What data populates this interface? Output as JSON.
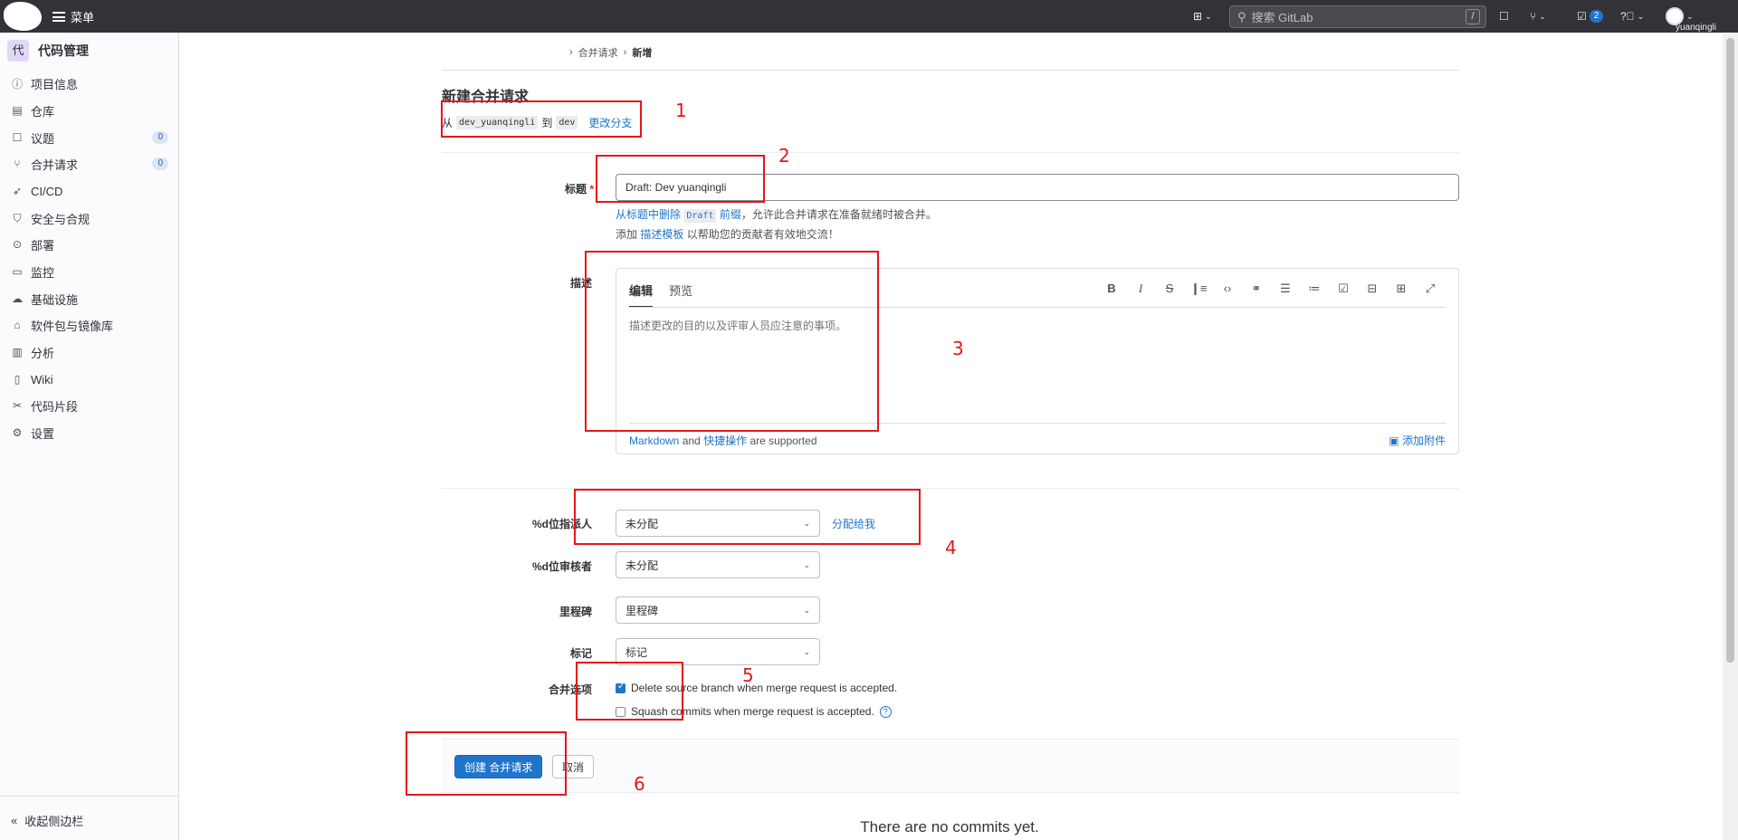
{
  "topbar": {
    "menu_label": "菜单",
    "search_placeholder": "搜索 GitLab",
    "search_shortcut": "/",
    "todo_count": "2",
    "username": "yuanqingli"
  },
  "sidebar": {
    "project_initial": "代",
    "project_name": "代码管理",
    "items": [
      {
        "label": "项目信息",
        "icon": "info-icon"
      },
      {
        "label": "仓库",
        "icon": "doc-icon"
      },
      {
        "label": "议题",
        "icon": "issues-icon",
        "badge": "0"
      },
      {
        "label": "合并请求",
        "icon": "merge-icon",
        "badge": "0"
      },
      {
        "label": "CI/CD",
        "icon": "rocket-icon"
      },
      {
        "label": "安全与合规",
        "icon": "shield-icon"
      },
      {
        "label": "部署",
        "icon": "deploy-icon"
      },
      {
        "label": "监控",
        "icon": "monitor-icon"
      },
      {
        "label": "基础设施",
        "icon": "cloud-icon"
      },
      {
        "label": "软件包与镜像库",
        "icon": "package-icon"
      },
      {
        "label": "分析",
        "icon": "chart-icon"
      },
      {
        "label": "Wiki",
        "icon": "book-icon"
      },
      {
        "label": "代码片段",
        "icon": "snippet-icon"
      },
      {
        "label": "设置",
        "icon": "gear-icon"
      }
    ],
    "collapse_label": "收起侧边栏"
  },
  "breadcrumb": {
    "item1": "合并请求",
    "item2": "新增"
  },
  "page": {
    "title": "新建合并请求",
    "from_label": "从",
    "source_branch": "dev_yuanqingli",
    "to_label": "到",
    "target_branch": "dev",
    "change_branches": "更改分支"
  },
  "form": {
    "title_label": "标题",
    "title_value": "Draft: Dev yuanqingli",
    "hint1_pre": "从标题中删除",
    "hint1_code": "Draft",
    "hint1_link": "前缀",
    "hint1_post": "，允许此合并请求在准备就绪时被合并。",
    "hint2_pre": "添加",
    "hint2_link": "描述模板",
    "hint2_post": "以帮助您的贡献者有效地交流！",
    "description_label": "描述",
    "tab_edit": "编辑",
    "tab_preview": "预览",
    "description_placeholder": "描述更改的目的以及评审人员应注意的事项。",
    "markdown_link": "Markdown",
    "and_text": "and",
    "quick_actions_link": "快捷操作",
    "supported_text": "are supported",
    "attach_label": "添加附件",
    "assignee_label": "%d位指派人",
    "assignee_value": "未分配",
    "assign_to_me": "分配给我",
    "reviewer_label": "%d位审核者",
    "reviewer_value": "未分配",
    "milestone_label": "里程碑",
    "milestone_value": "里程碑",
    "labels_label": "标记",
    "labels_value": "标记",
    "merge_options_label": "合并选项",
    "option_delete_branch": "Delete source branch when merge request is accepted.",
    "option_delete_branch_checked": true,
    "option_squash": "Squash commits when merge request is accepted.",
    "option_squash_checked": false,
    "submit_label": "创建 合并请求",
    "cancel_label": "取消"
  },
  "commits_empty": "There are no commits yet.",
  "annotations": [
    "1",
    "2",
    "3",
    "4",
    "5",
    "6"
  ]
}
